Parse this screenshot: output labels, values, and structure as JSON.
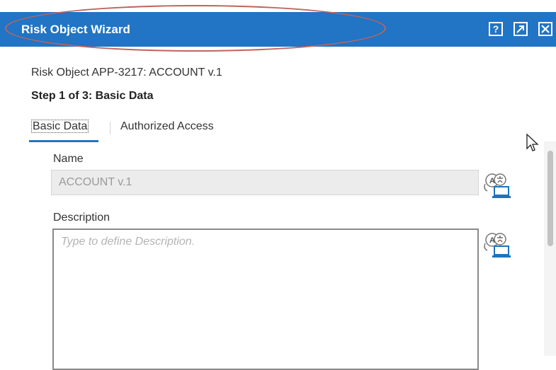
{
  "dialog": {
    "title": "Risk Object Wizard",
    "help_glyph": "?",
    "titlebar_color": "#2274c4"
  },
  "content": {
    "object_line": "Risk Object APP-3217: ACCOUNT v.1",
    "step_line": "Step 1 of 3: Basic Data"
  },
  "tabs": [
    {
      "label": "Basic Data",
      "active": true
    },
    {
      "label": "Authorized Access",
      "active": false
    }
  ],
  "form": {
    "name": {
      "label": "Name",
      "value": "ACCOUNT v.1"
    },
    "description": {
      "label": "Description",
      "placeholder": "Type to define Description.",
      "value": ""
    }
  },
  "icons": {
    "help": "help-icon",
    "popout": "popout-icon",
    "close": "close-icon",
    "translate": "translate-icon",
    "cursor": "mouse-cursor-icon"
  },
  "colors": {
    "accent": "#2274c4",
    "annotation": "#c0645a"
  }
}
